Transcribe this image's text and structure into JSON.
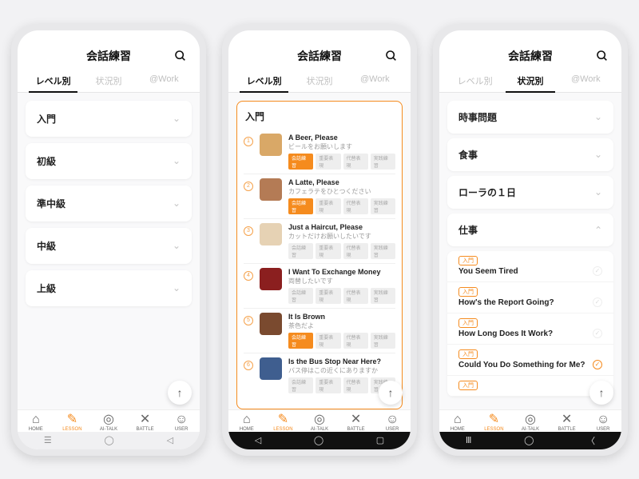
{
  "header": {
    "title": "会話練習"
  },
  "tabs": {
    "t1": "レベル別",
    "t2": "状況別",
    "t3": "@Work"
  },
  "bottomNav": {
    "home": "HOME",
    "lesson": "LESSON",
    "aitalk": "AI-TALK",
    "battle": "BATTLE",
    "user": "USER"
  },
  "screen1": {
    "levels": [
      "入門",
      "初級",
      "準中級",
      "中級",
      "上級"
    ]
  },
  "screen2": {
    "panelTitle": "入門",
    "lessons": [
      {
        "n": "1",
        "en": "A Beer, Please",
        "jp": "ビールをお願いします",
        "thumb": "#d9a867",
        "orange": true
      },
      {
        "n": "2",
        "en": "A Latte, Please",
        "jp": "カフェラテをひとつください",
        "thumb": "#b47b55",
        "orange": true
      },
      {
        "n": "3",
        "en": "Just a Haircut, Please",
        "jp": "カットだけお願いしたいです",
        "thumb": "#e6d2b4",
        "orange": false
      },
      {
        "n": "4",
        "en": "I Want To Exchange Money",
        "jp": "両替したいです",
        "thumb": "#8b1f1f",
        "orange": false
      },
      {
        "n": "5",
        "en": "It Is Brown",
        "jp": "茶色だよ",
        "thumb": "#7a4a2f",
        "orange": true
      },
      {
        "n": "6",
        "en": "Is the Bus Stop Near Here?",
        "jp": "バス停はこの近くにありますか",
        "thumb": "#3f5e8f",
        "orange": false
      }
    ],
    "tagLabels": {
      "a": "会話練習",
      "b": "重要表現",
      "c": "代替表現",
      "d": "実践練習"
    }
  },
  "screen3": {
    "cats": [
      "時事問題",
      "食事",
      "ローラの１日",
      "仕事"
    ],
    "subLevel": "入門",
    "subs": [
      {
        "t": "You Seem Tired",
        "done": false
      },
      {
        "t": "How's the Report Going?",
        "done": false
      },
      {
        "t": "How Long Does It Work?",
        "done": false
      },
      {
        "t": "Could You Do Something for Me?",
        "done": true
      }
    ]
  }
}
